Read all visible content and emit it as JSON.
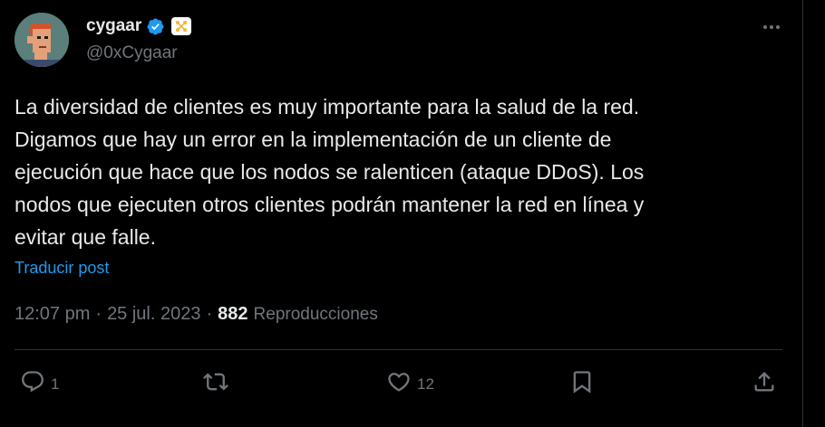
{
  "author": {
    "display_name": "cygaar",
    "handle": "@0xCygaar",
    "verified_icon": "verified-badge-icon",
    "affiliate_icon": "affiliate-badge-icon"
  },
  "post": {
    "text": "La diversidad de clientes es muy importante para la salud de la red.\nDigamos que hay un error en la implementación de un cliente de\nejecución que hace que los nodos se ralenticen (ataque DDoS). Los\nnodos que ejecuten otros clientes podrán mantener la red en línea y\nevitar que falle.",
    "translate_label": "Traducir post",
    "time": "12:07 pm",
    "date": "25 jul. 2023",
    "separator": "·",
    "views_count": "882",
    "views_label": "Reproducciones"
  },
  "actions": {
    "reply_count": "1",
    "repost_count": "",
    "like_count": "12"
  },
  "colors": {
    "background": "#000000",
    "text": "#e7e9ea",
    "muted": "#71767b",
    "link": "#1d9bf0",
    "verified": "#1d9bf0"
  }
}
